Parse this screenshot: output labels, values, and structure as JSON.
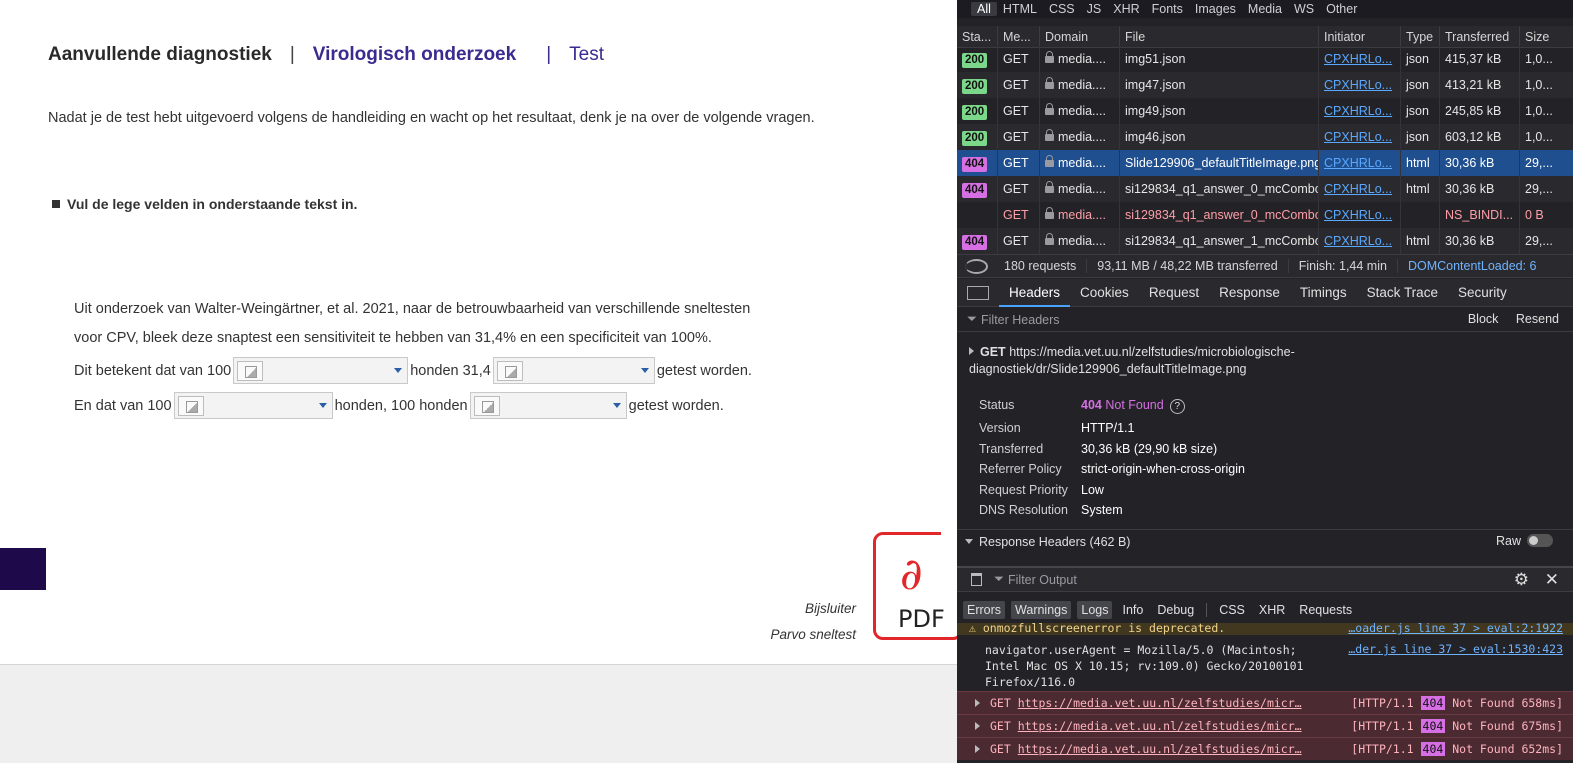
{
  "page": {
    "breadcrumb": [
      "Aanvullende diagnostiek",
      "|",
      "Virologisch onderzoek",
      "|",
      "Test"
    ],
    "intro": "Nadat je de test hebt uitgevoerd volgens de handleiding en wacht op het resultaat, denk je na over de volgende vragen.",
    "task": "Vul de lege velden in onderstaande tekst in.",
    "para_line1": "Uit onderzoek van Walter-Weingärtner, et al. 2021, naar de betrouwbaarheid van verschillende sneltesten",
    "para_line2": "voor CPV, bleek deze snaptest een sensitiviteit te hebben van 31,4% en een specificiteit van 100%.",
    "row1": {
      "a": "Dit betekent dat van 100",
      "b": "honden 31,4",
      "c": "getest worden."
    },
    "row2": {
      "a": "En dat van 100",
      "b": "honden, 100 honden",
      "c": "getest worden."
    },
    "bijsluiter": "Bijsluiter",
    "parvo": "Parvo sneltest",
    "pdf_label": "PDF"
  },
  "devtools": {
    "filter_tabs": [
      "All",
      "HTML",
      "CSS",
      "JS",
      "XHR",
      "Fonts",
      "Images",
      "Media",
      "WS",
      "Other"
    ],
    "columns": [
      "Sta...",
      "Me...",
      "Domain",
      "File",
      "Initiator",
      "Type",
      "Transferred",
      "Size"
    ],
    "rows": [
      {
        "status": "200",
        "method": "GET",
        "domain": "media....",
        "file": "img51.json",
        "initiator": "CPXHRLo...",
        "type": "json",
        "transferred": "415,37 kB",
        "size": "1,0..."
      },
      {
        "status": "200",
        "method": "GET",
        "domain": "media....",
        "file": "img47.json",
        "initiator": "CPXHRLo...",
        "type": "json",
        "transferred": "413,21 kB",
        "size": "1,0..."
      },
      {
        "status": "200",
        "method": "GET",
        "domain": "media....",
        "file": "img49.json",
        "initiator": "CPXHRLo...",
        "type": "json",
        "transferred": "245,85 kB",
        "size": "1,0..."
      },
      {
        "status": "200",
        "method": "GET",
        "domain": "media....",
        "file": "img46.json",
        "initiator": "CPXHRLo...",
        "type": "json",
        "transferred": "603,12 kB",
        "size": "1,0..."
      },
      {
        "status": "404",
        "method": "GET",
        "domain": "media....",
        "file": "Slide129906_defaultTitleImage.png",
        "initiator": "CPXHRLo...",
        "type": "html",
        "transferred": "30,36 kB",
        "size": "29,..."
      },
      {
        "status": "404",
        "method": "GET",
        "domain": "media....",
        "file": "si129834_q1_answer_0_mcCombo",
        "initiator": "CPXHRLo...",
        "type": "html",
        "transferred": "30,36 kB",
        "size": "29,..."
      },
      {
        "status": "",
        "method": "GET",
        "domain": "media....",
        "file": "si129834_q1_answer_0_mcCombo",
        "initiator": "CPXHRLo...",
        "type": "",
        "transferred": "NS_BINDI...",
        "size": "0 B"
      },
      {
        "status": "404",
        "method": "GET",
        "domain": "media....",
        "file": "si129834_q1_answer_1_mcCombo",
        "initiator": "CPXHRLo...",
        "type": "html",
        "transferred": "30,36 kB",
        "size": "29,..."
      }
    ],
    "summary": {
      "requests": "180 requests",
      "transferred": "93,11 MB / 48,22 MB transferred",
      "finish": "Finish: 1,44 min",
      "dom": "DOMContentLoaded: 6"
    },
    "detail_tabs": [
      "Headers",
      "Cookies",
      "Request",
      "Response",
      "Timings",
      "Stack Trace",
      "Security"
    ],
    "filter_headers": "Filter Headers",
    "block": "Block",
    "resend": "Resend",
    "request_method": "GET",
    "request_url": "https://media.vet.uu.nl/zelfstudies/microbiologische-diagnostiek/dr/Slide129906_defaultTitleImage.png",
    "kv": [
      {
        "k": "Status",
        "v": "Not Found",
        "code": "404"
      },
      {
        "k": "Version",
        "v": "HTTP/1.1"
      },
      {
        "k": "Transferred",
        "v": "30,36 kB (29,90 kB size)"
      },
      {
        "k": "Referrer Policy",
        "v": "strict-origin-when-cross-origin"
      },
      {
        "k": "Request Priority",
        "v": "Low"
      },
      {
        "k": "DNS Resolution",
        "v": "System"
      }
    ],
    "response_headers": "Response Headers (462 B)",
    "raw": "Raw",
    "filter_output": "Filter Output",
    "console_tabs": [
      "Errors",
      "Warnings",
      "Logs",
      "Info",
      "Debug",
      "CSS",
      "XHR",
      "Requests"
    ],
    "warn_text": "onmozfullscreenerror is deprecated.",
    "warn_src": "…oader.js line 37 > eval:2:1922",
    "ua_text": "navigator.userAgent = Mozilla/5.0 (Macintosh;\nIntel Mac OS X 10.15; rv:109.0) Gecko/20100101\nFirefox/116.0",
    "ua_src": "…der.js line 37 > eval:1530:423",
    "errors": [
      {
        "method": "GET",
        "url": "https://media.vet.uu.nl/zelfstudies/micr…",
        "proto": "[HTTP/1.1",
        "code": "404",
        "msg": "Not Found 658ms]"
      },
      {
        "method": "GET",
        "url": "https://media.vet.uu.nl/zelfstudies/micr…",
        "proto": "[HTTP/1.1",
        "code": "404",
        "msg": "Not Found 675ms]"
      },
      {
        "method": "GET",
        "url": "https://media.vet.uu.nl/zelfstudies/micr…",
        "proto": "[HTTP/1.1",
        "code": "404",
        "msg": "Not Found 652ms]"
      }
    ],
    "colors": {
      "bg": "#232327",
      "selected": "#1f4f8f",
      "ok": "#7bd88a",
      "notfound": "#d66fe4"
    }
  }
}
